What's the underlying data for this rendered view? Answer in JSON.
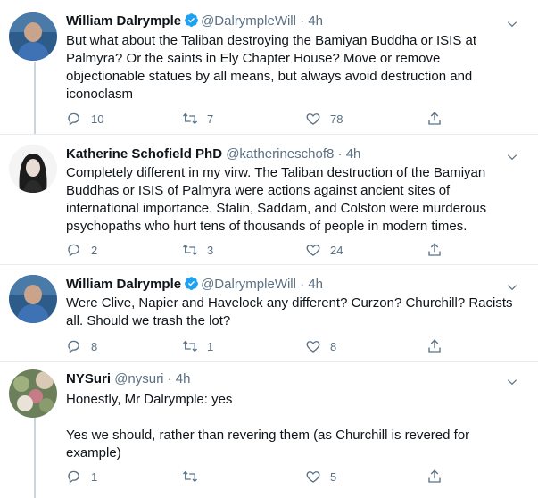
{
  "colors": {
    "accent": "#1da1f2",
    "muted": "#5b7083",
    "text": "#0f1419",
    "divider": "#e6ecf0"
  },
  "tweets": [
    {
      "name": "William Dalrymple",
      "verified": true,
      "handle": "@DalrympleWill",
      "dot": "·",
      "time": "4h",
      "text": "But what about the Taliban destroying the Bamiyan Buddha or ISIS at Palmyra? Or the saints in Ely Chapter House? Move or remove objectionable statues by all means, but always avoid destruction and iconoclasm",
      "replies": "10",
      "retweets": "7",
      "likes": "78"
    },
    {
      "name": "Katherine Schofield PhD",
      "verified": false,
      "handle": "@katherineschof8",
      "dot": "·",
      "time": "4h",
      "text": "Completely different in my virw. The Taliban destruction of the Bamiyan Buddhas or ISIS of Palmyra were actions against ancient sites of international importance. Stalin, Saddam, and Colston were murderous psychopaths who hurt tens of thousands of people in modern times.",
      "replies": "2",
      "retweets": "3",
      "likes": "24"
    },
    {
      "name": "William Dalrymple",
      "verified": true,
      "handle": "@DalrympleWill",
      "dot": "·",
      "time": "4h",
      "text": "Were Clive, Napier and Havelock any different? Curzon? Churchill? Racists all. Should we trash the lot?",
      "replies": "8",
      "retweets": "1",
      "likes": "8"
    },
    {
      "name": "NYSuri",
      "verified": false,
      "handle": "@nysuri",
      "dot": "·",
      "time": "4h",
      "text": "Honestly, Mr Dalrymple: yes",
      "text2": "Yes we should, rather than revering them (as Churchill is revered for example)",
      "replies": "1",
      "retweets": "",
      "likes": "5"
    }
  ]
}
